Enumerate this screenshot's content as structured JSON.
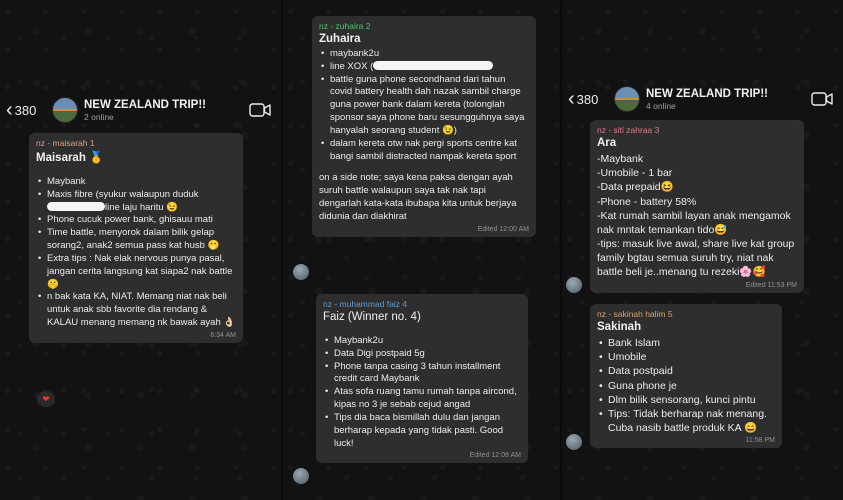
{
  "left": {
    "header": {
      "back_count": "380",
      "title": "NEW ZEALAND TRIP!!",
      "subtitle": "2 online"
    },
    "message": {
      "sender": "nz - maisarah 1",
      "sender_color": "#e0a184",
      "name": "Maisarah 🥇",
      "items_a": [
        "Maybank",
        "Maxis fibre (syukur walaupun duduk",
        "Phone cucuk power bank, ghisauu mati",
        "Time battle, menyorok dalam bilik gelap sorang2, anak2 semua pass kat husb 🫢",
        "Extra tips : Nak elak nervous punya pasal, jangan cerita langsung kat siapa2 nak battle 🤫",
        "n bak kata KA, NIAT. Memang niat nak beli untuk anak sbb favorite dia rendang & KALAU menang memang nk bawak ayah 👌🏻"
      ],
      "maxis_line2": "line laju haritu 😉",
      "time": "6:34 AM",
      "reaction": "❤"
    }
  },
  "mid": {
    "message1": {
      "sender": "nz - zuhaira 2",
      "sender_color": "#4cc46a",
      "name": "Zuhaira",
      "items": [
        "maybank2u",
        "line XOX (",
        "battle guna phone secondhand dari tahun covid battery health dah nazak sambil charge guna power bank dalam kereta (tolonglah sponsor saya phone baru sesungguhnya saya hanyalah seorang student 😉)",
        "dalam kereta otw nak pergi sports centre kat bangi sambil distracted nampak kereta sport"
      ],
      "note": "on a side note; saya kena paksa dengan ayah suruh battle walaupun saya tak nak tapi dengarlah kata-kata ibubapa kita untuk berjaya didunia dan diakhirat",
      "time": "Edited 12:00 AM"
    },
    "message2": {
      "sender": "nz - muhammad faiz 4",
      "sender_color": "#5b9bd5",
      "name": "Faiz (Winner no. 4)",
      "items": [
        "Maybank2u",
        "Data Digi postpaid 5g",
        "Phone tanpa casing 3 tahun installment credit card Maybank",
        "Atas sofa ruang tamu rumah tanpa aircond, kipas no 3 je sebab cejud angad",
        "Tips dia baca bismillah dulu dan jangan berharap kepada yang tidak pasti. Good luck!"
      ],
      "time": "Edited 12:08 AM"
    }
  },
  "right": {
    "header": {
      "back_count": "380",
      "title": "NEW ZEALAND TRIP!!",
      "subtitle": "4 online"
    },
    "message1": {
      "sender": "nz - siti zahraa 3",
      "sender_color": "#e07a8c",
      "name": "Ara",
      "lines": [
        "-Maybank",
        "-Umobile - 1 bar",
        "-Data prepaid😆",
        "-Phone - battery 58%",
        "-Kat rumah sambil layan anak mengamok nak mntak temankan tido😅",
        "-tips: masuk live awal, share live kat group family bgtau semua suruh try, niat nak battle beli je..menang tu rezeki🌸🥰"
      ],
      "time": "Edited 11:53 PM"
    },
    "message2": {
      "sender": "nz - sakinah halim 5",
      "sender_color": "#d9a36b",
      "name": "Sakinah",
      "items": [
        "Bank Islam",
        "Umobile",
        "Data postpaid",
        "Guna phone je",
        "Dlm bilik sensorang, kunci pintu",
        "Tips: Tidak berharap nak menang. Cuba nasib battle produk KA 😄"
      ],
      "time": "11:58 PM"
    }
  },
  "icons": {
    "back": "chevron-left-icon",
    "video": "video-call-icon"
  }
}
